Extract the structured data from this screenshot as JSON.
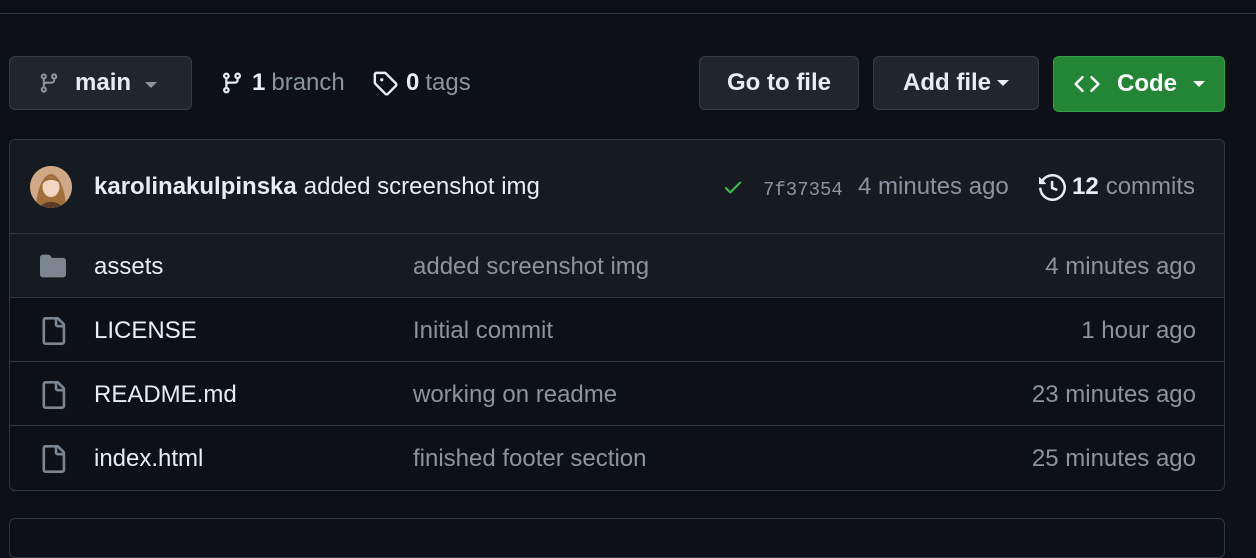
{
  "toolbar": {
    "branch_name": "main",
    "branches_count": "1",
    "branches_label": "branch",
    "tags_count": "0",
    "tags_label": "tags",
    "go_to_file_label": "Go to file",
    "add_file_label": "Add file",
    "code_label": "Code"
  },
  "latest_commit": {
    "author": "karolinakulpinska",
    "message": "added screenshot img",
    "status": "success",
    "sha": "7f37354",
    "time": "4 minutes ago",
    "commits_count": "12",
    "commits_label": "commits"
  },
  "files": [
    {
      "type": "folder",
      "name": "assets",
      "message": "added screenshot img",
      "time": "4 minutes ago"
    },
    {
      "type": "file",
      "name": "LICENSE",
      "message": "Initial commit",
      "time": "1 hour ago"
    },
    {
      "type": "file",
      "name": "README.md",
      "message": "working on readme",
      "time": "23 minutes ago"
    },
    {
      "type": "file",
      "name": "index.html",
      "message": "finished footer section",
      "time": "25 minutes ago"
    }
  ],
  "colors": {
    "background": "#0d1117",
    "accent_green": "#238636",
    "check_green": "#3fb950",
    "muted_text": "#8b949e"
  }
}
